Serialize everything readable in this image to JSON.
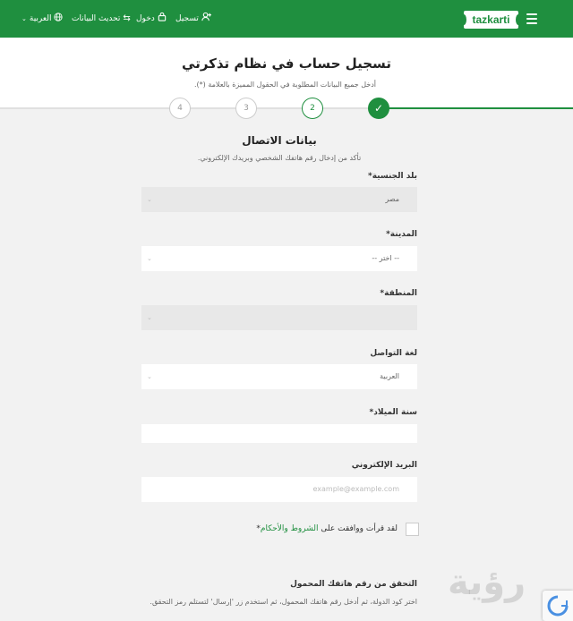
{
  "topbar": {
    "logo": "tazkarti",
    "register": "تسجيل",
    "login": "دخول",
    "update": "تحديث البيانات",
    "language": "العربية"
  },
  "header": {
    "title": "تسجيل حساب في نظام تذكرتي",
    "subtitle": "أدخل جميع البيانات المطلوبة في الحقول المميزة بالعلامة (*)."
  },
  "stepper": {
    "steps": [
      "✓",
      "2",
      "3",
      "4"
    ],
    "current": 2
  },
  "form": {
    "title": "بيانات الاتصال",
    "subtitle": "تأكد من إدخال رقم هاتفك الشخصي وبريدك الإلكتروني.",
    "nationality": {
      "label": "بلد الجنسية*",
      "value": "مصر"
    },
    "city": {
      "label": "المدينة*",
      "value": "-- اختر --"
    },
    "region": {
      "label": "المنطقة*",
      "value": ""
    },
    "language": {
      "label": "لغة التواصل",
      "value": "العربية"
    },
    "birth_year": {
      "label": "سنة الميلاد*",
      "value": ""
    },
    "email": {
      "label": "البريد الإلكتروني",
      "placeholder": "example@example.com"
    },
    "terms": {
      "prefix": "لقد قرأت ووافقت على",
      "link": "الشروط والأحكام",
      "required": "*"
    },
    "verify": {
      "title": "التحقق من رقم هاتفك المحمول",
      "text": "اختر كود الدولة، ثم أدخل رقم هاتفك المحمول، ثم استخدم زر 'إرسال' لتستلم رمز التحقق."
    }
  }
}
